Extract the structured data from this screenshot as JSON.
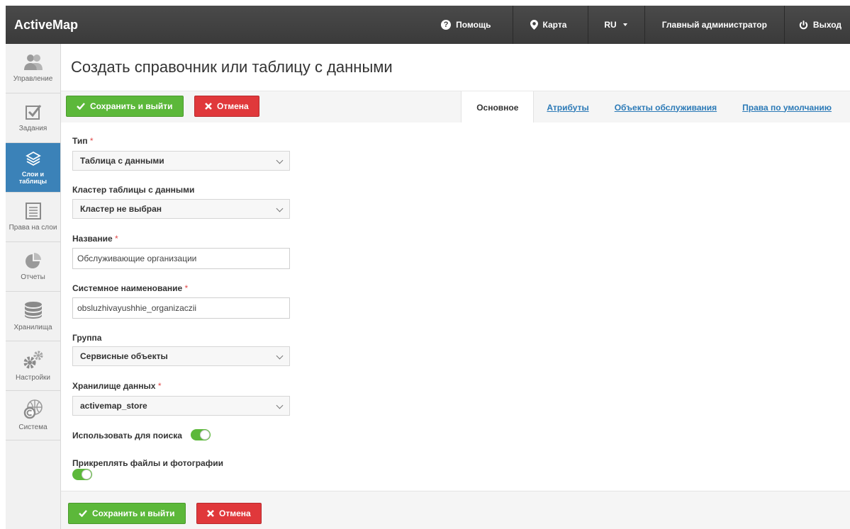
{
  "app": {
    "brand": "ActiveMap"
  },
  "topnav": {
    "help": "Помощь",
    "map": "Карта",
    "lang": "RU",
    "user": "Главный администратор",
    "exit": "Выход"
  },
  "sidebar": {
    "items": [
      {
        "label": "Управление",
        "icon": "users-icon"
      },
      {
        "label": "Задания",
        "icon": "checkbox-icon"
      },
      {
        "label": "Слои и таблицы",
        "icon": "layers-icon",
        "active": true
      },
      {
        "label": "Права на слои",
        "icon": "list-icon"
      },
      {
        "label": "Отчеты",
        "icon": "pie-chart-icon"
      },
      {
        "label": "Хранилища",
        "icon": "database-icon"
      },
      {
        "label": "Настройки",
        "icon": "gears-icon"
      },
      {
        "label": "Система",
        "icon": "globe-icon"
      }
    ]
  },
  "page": {
    "title": "Создать справочник или таблицу с данными"
  },
  "toolbar": {
    "save_label": "Сохранить и выйти",
    "cancel_label": "Отмена"
  },
  "tabs": [
    {
      "label": "Основное",
      "active": true
    },
    {
      "label": "Атрибуты"
    },
    {
      "label": "Объекты обслуживания"
    },
    {
      "label": "Права по умолчанию"
    }
  ],
  "form": {
    "type_label": "Тип",
    "type_value": "Таблица с данными",
    "cluster_label": "Кластер таблицы с данными",
    "cluster_value": "Кластер не выбран",
    "name_label": "Название",
    "name_value": "Обслуживающие организации",
    "sysname_label": "Системное наименование",
    "sysname_value": "obsluzhivayushhie_organizaczii",
    "group_label": "Группа",
    "group_value": "Сервисные объекты",
    "storage_label": "Хранилище данных",
    "storage_value": "activemap_store",
    "search_label": "Использовать для поиска",
    "search_enabled": true,
    "attach_label": "Прикреплять файлы и фотографии",
    "attach_enabled": true,
    "required_mark": "*"
  },
  "colors": {
    "accent": "#3b82b8",
    "save": "#5cb83a",
    "cancel": "#e0383b",
    "topbar": "#3f3f3f",
    "link": "#2c7ab7"
  }
}
